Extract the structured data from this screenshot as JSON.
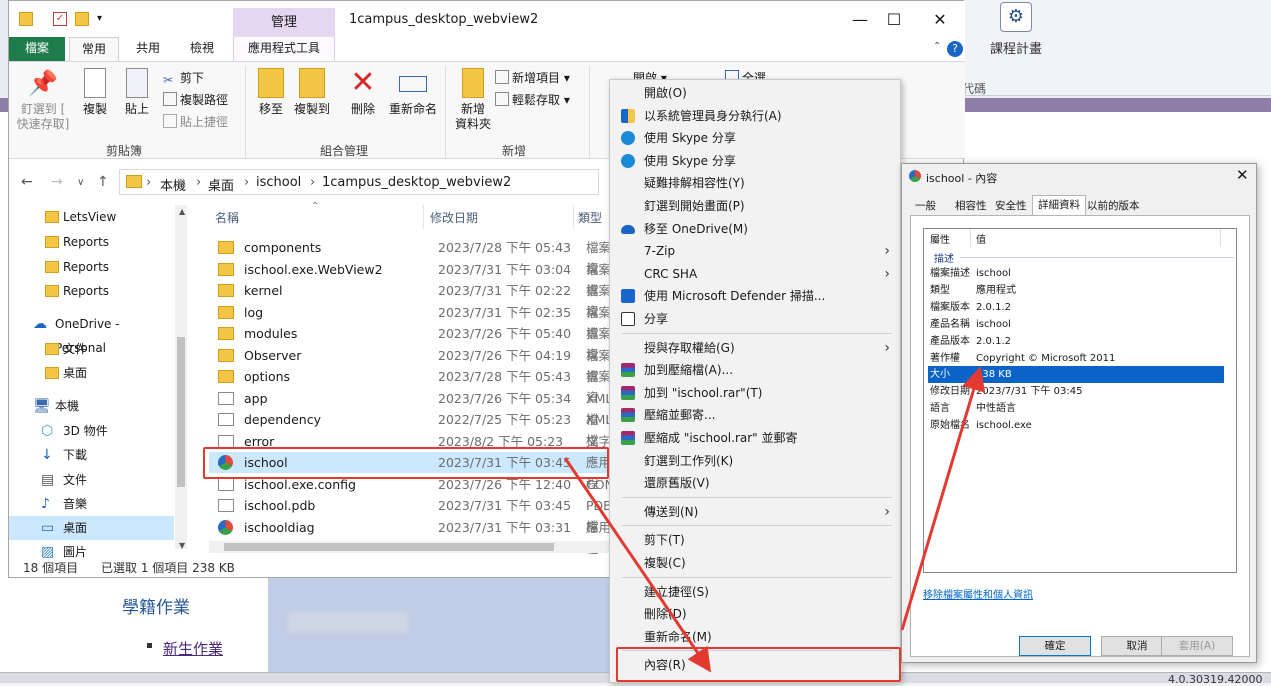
{
  "background_app": {
    "course_plan": "課程計畫",
    "code": "代碼",
    "edu_section": "學籍作業",
    "new_student": "新生作業",
    "version": "4.0.30319.42000"
  },
  "explorer": {
    "title": "1campus_desktop_webview2",
    "manage_tab": "管理",
    "tabs": {
      "file": "檔案",
      "home": "常用",
      "share": "共用",
      "view": "檢視",
      "app_tools": "應用程式工具"
    },
    "ribbon": {
      "pin": "釘選到 [\n快速存取]",
      "copy": "複製",
      "paste": "貼上",
      "cut": "剪下",
      "copy_path": "複製路徑",
      "paste_shortcut": "貼上捷徑",
      "clipboard_group": "剪貼簿",
      "move_to": "移至",
      "copy_to": "複製到",
      "delete": "刪除",
      "rename": "重新命名",
      "organize_group": "組合管理",
      "new_folder": "新增\n資料夾",
      "new_item": "新增項目",
      "easy_access": "輕鬆存取",
      "new_group": "新增",
      "open": "開啟",
      "select_all": "全選"
    },
    "address": {
      "crumbs": [
        "本機",
        "桌面",
        "ischool",
        "1campus_desktop_webview2"
      ]
    },
    "nav": [
      {
        "label": "LetsView",
        "kind": "folder"
      },
      {
        "label": "Reports",
        "kind": "folder"
      },
      {
        "label": "Reports",
        "kind": "folder"
      },
      {
        "label": "Reports",
        "kind": "folder"
      },
      {
        "label": "OneDrive - Personal",
        "kind": "onedrive"
      },
      {
        "label": "文件",
        "kind": "folder"
      },
      {
        "label": "桌面",
        "kind": "folder"
      },
      {
        "label": "本機",
        "kind": "pc"
      },
      {
        "label": "3D 物件",
        "kind": "3d"
      },
      {
        "label": "下載",
        "kind": "download"
      },
      {
        "label": "文件",
        "kind": "doc"
      },
      {
        "label": "音樂",
        "kind": "music"
      },
      {
        "label": "桌面",
        "kind": "desktop"
      },
      {
        "label": "圖片",
        "kind": "pic"
      }
    ],
    "columns": {
      "name": "名稱",
      "date": "修改日期",
      "type": "類型"
    },
    "files": [
      {
        "name": "components",
        "date": "2023/7/28 下午 05:43",
        "type": "檔案資",
        "kind": "folder"
      },
      {
        "name": "ischool.exe.WebView2",
        "date": "2023/7/31 下午 03:04",
        "type": "檔案資",
        "kind": "folder"
      },
      {
        "name": "kernel",
        "date": "2023/7/31 下午 02:22",
        "type": "檔案資",
        "kind": "folder"
      },
      {
        "name": "log",
        "date": "2023/7/31 下午 02:35",
        "type": "檔案資",
        "kind": "folder"
      },
      {
        "name": "modules",
        "date": "2023/7/26 下午 05:40",
        "type": "檔案資",
        "kind": "folder"
      },
      {
        "name": "Observer",
        "date": "2023/7/26 下午 04:19",
        "type": "檔案資",
        "kind": "folder"
      },
      {
        "name": "options",
        "date": "2023/7/28 下午 05:43",
        "type": "檔案資",
        "kind": "folder"
      },
      {
        "name": "app",
        "date": "2023/7/26 下午 05:34",
        "type": "XML 檔",
        "kind": "file"
      },
      {
        "name": "dependency",
        "date": "2022/7/25 下午 05:23",
        "type": "XML 檔",
        "kind": "file"
      },
      {
        "name": "error",
        "date": "2023/8/2 下午 05:23",
        "type": "文字文",
        "kind": "file"
      },
      {
        "name": "ischool",
        "date": "2023/7/31 下午 03:45",
        "type": "應用程",
        "kind": "app"
      },
      {
        "name": "ischool.exe.config",
        "date": "2023/7/26 下午 12:40",
        "type": "CONFI",
        "kind": "file"
      },
      {
        "name": "ischool.pdb",
        "date": "2023/7/31 下午 03:45",
        "type": "PDB 檔",
        "kind": "file"
      },
      {
        "name": "ischooldiag",
        "date": "2023/7/31 下午 03:31",
        "type": "應用程",
        "kind": "app"
      }
    ],
    "status": {
      "count": "18 個項目",
      "selected": "已選取 1 個項目  238 KB"
    }
  },
  "context_menu": {
    "items": [
      {
        "label": "開啟(O)",
        "icon": "",
        "sub": false
      },
      {
        "label": "以系統管理員身分執行(A)",
        "icon": "shield",
        "sub": false
      },
      {
        "label": "使用 Skype 分享",
        "icon": "skype",
        "sub": false
      },
      {
        "label": "使用 Skype 分享",
        "icon": "skype",
        "sub": false
      },
      {
        "label": "疑難排解相容性(Y)",
        "icon": "",
        "sub": false
      },
      {
        "label": "釘選到開始畫面(P)",
        "icon": "",
        "sub": false
      },
      {
        "label": "移至 OneDrive(M)",
        "icon": "onedrive",
        "sub": false
      },
      {
        "label": "7-Zip",
        "icon": "",
        "sub": true
      },
      {
        "label": "CRC SHA",
        "icon": "",
        "sub": true
      },
      {
        "label": "使用 Microsoft Defender 掃描...",
        "icon": "defender",
        "sub": false
      },
      {
        "label": "分享",
        "icon": "share",
        "sub": false
      },
      {
        "sep": true
      },
      {
        "label": "授與存取權給(G)",
        "icon": "",
        "sub": true
      },
      {
        "label": "加到壓縮檔(A)...",
        "icon": "rar",
        "sub": false
      },
      {
        "label": "加到 \"ischool.rar\"(T)",
        "icon": "rar",
        "sub": false
      },
      {
        "label": "壓縮並郵寄...",
        "icon": "rar",
        "sub": false
      },
      {
        "label": "壓縮成 \"ischool.rar\" 並郵寄",
        "icon": "rar",
        "sub": false
      },
      {
        "label": "釘選到工作列(K)",
        "icon": "",
        "sub": false
      },
      {
        "label": "還原舊版(V)",
        "icon": "",
        "sub": false
      },
      {
        "sep": true
      },
      {
        "label": "傳送到(N)",
        "icon": "",
        "sub": true
      },
      {
        "sep": true
      },
      {
        "label": "剪下(T)",
        "icon": "",
        "sub": false
      },
      {
        "label": "複製(C)",
        "icon": "",
        "sub": false
      },
      {
        "sep": true
      },
      {
        "label": "建立捷徑(S)",
        "icon": "",
        "sub": false
      },
      {
        "label": "刪除(D)",
        "icon": "",
        "sub": false
      },
      {
        "label": "重新命名(M)",
        "icon": "",
        "sub": false
      },
      {
        "sep": true
      },
      {
        "label": "內容(R)",
        "icon": "",
        "sub": false
      }
    ]
  },
  "properties": {
    "title": "ischool - 內容",
    "tabs": [
      "一般",
      "相容性",
      "安全性",
      "詳細資料",
      "以前的版本"
    ],
    "list_head": {
      "prop": "屬性",
      "value": "值"
    },
    "section": "描述",
    "rows": [
      {
        "k": "檔案描述",
        "v": "ischool"
      },
      {
        "k": "類型",
        "v": "應用程式"
      },
      {
        "k": "檔案版本",
        "v": "2.0.1.2"
      },
      {
        "k": "產品名稱",
        "v": "ischool"
      },
      {
        "k": "產品版本",
        "v": "2.0.1.2"
      },
      {
        "k": "著作權",
        "v": "Copyright © Microsoft 2011"
      },
      {
        "k": "大小",
        "v": "238 KB"
      },
      {
        "k": "修改日期",
        "v": "2023/7/31 下午 03:45"
      },
      {
        "k": "語言",
        "v": "中性語言"
      },
      {
        "k": "原始檔名",
        "v": "ischool.exe"
      }
    ],
    "remove_link": "移除檔案屬性和個人資訊",
    "ok": "確定",
    "cancel": "取消",
    "apply": "套用(A)"
  },
  "colors": {
    "highlight": "#e23a30",
    "selection": "#cce8ff",
    "file_tab": "#1e7b4c"
  }
}
